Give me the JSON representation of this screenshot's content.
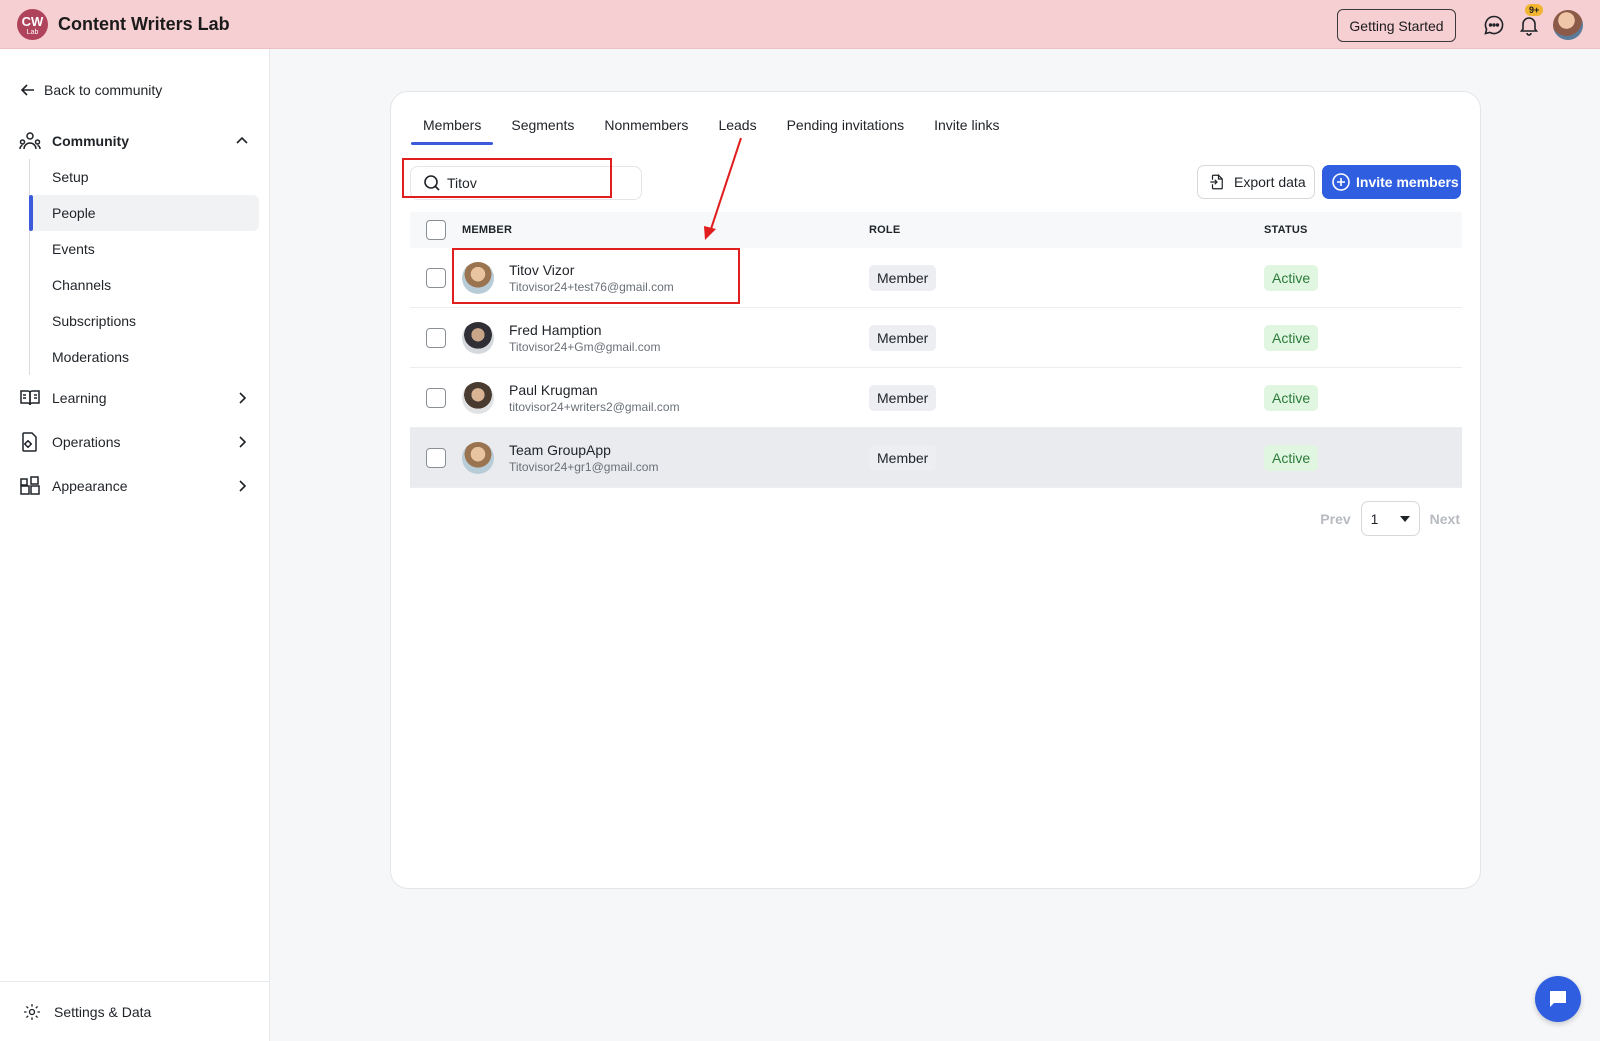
{
  "header": {
    "logo_text": "CW",
    "logo_sub": "Lab",
    "brand": "Content Writers Lab",
    "getting_started": "Getting Started",
    "notif_badge": "9+"
  },
  "sidebar": {
    "back": "Back to community",
    "community": "Community",
    "community_items": [
      "Setup",
      "People",
      "Events",
      "Channels",
      "Subscriptions",
      "Moderations"
    ],
    "active_item": "People",
    "learning": "Learning",
    "operations": "Operations",
    "appearance": "Appearance",
    "settings": "Settings & Data"
  },
  "tabs": [
    "Members",
    "Segments",
    "Nonmembers",
    "Leads",
    "Pending invitations",
    "Invite links"
  ],
  "active_tab": "Members",
  "search": {
    "value": "Titov"
  },
  "actions": {
    "export": "Export data",
    "invite": "Invite members"
  },
  "table": {
    "headers": {
      "member": "MEMBER",
      "role": "ROLE",
      "status": "STATUS"
    },
    "rows": [
      {
        "name": "Titov Vizor",
        "email": "Titovisor24+test76@gmail.com",
        "role": "Member",
        "status": "Active"
      },
      {
        "name": "Fred Hamption",
        "email": "Titovisor24+Gm@gmail.com",
        "role": "Member",
        "status": "Active"
      },
      {
        "name": "Paul Krugman",
        "email": "titovisor24+writers2@gmail.com",
        "role": "Member",
        "status": "Active"
      },
      {
        "name": "Team GroupApp",
        "email": "Titovisor24+gr1@gmail.com",
        "role": "Member",
        "status": "Active"
      }
    ]
  },
  "pagination": {
    "prev": "Prev",
    "page": "1",
    "next": "Next"
  },
  "colors": {
    "accent": "#2f5fe0",
    "header_bg": "#f6cfd2",
    "annotation": "#e01e1e"
  }
}
